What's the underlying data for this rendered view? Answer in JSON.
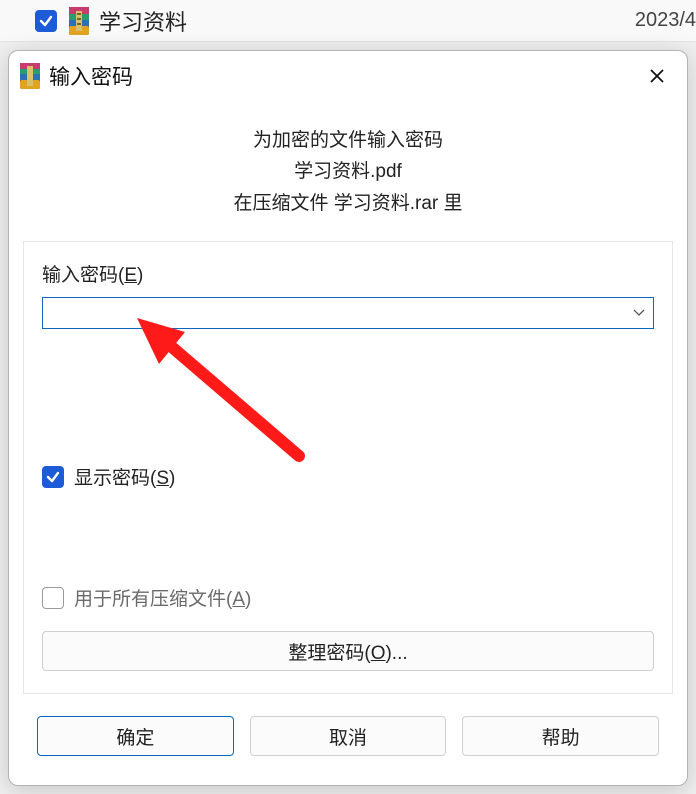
{
  "background": {
    "filename": "学习资料",
    "date": "2023/4"
  },
  "dialog": {
    "title": "输入密码",
    "prompt": {
      "line1": "为加密的文件输入密码",
      "line2": "学习资料.pdf",
      "line3": "在压缩文件 学习资料.rar 里"
    },
    "passwordLabel": {
      "prefix": "输入密码(",
      "mnemonic": "E",
      "suffix": ")"
    },
    "passwordValue": "",
    "showPassword": {
      "prefix": "显示密码(",
      "mnemonic": "S",
      "suffix": ")"
    },
    "allArchives": {
      "prefix": "用于所有压缩文件(",
      "mnemonic": "A",
      "suffix": ")"
    },
    "organize": {
      "prefix": "整理密码(",
      "mnemonic": "O",
      "suffix": ")..."
    },
    "buttons": {
      "ok": "确定",
      "cancel": "取消",
      "help": "帮助"
    }
  }
}
